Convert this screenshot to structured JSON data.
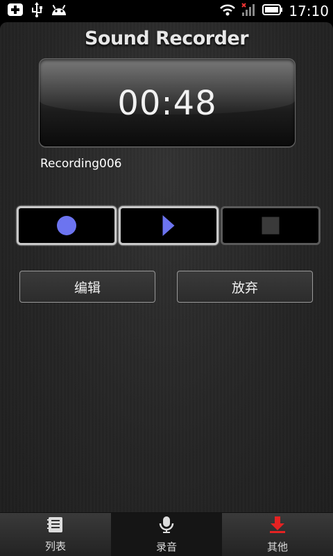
{
  "status_bar": {
    "time": "17:10",
    "left_icons": [
      "add-icon",
      "usb-icon",
      "android-icon"
    ],
    "right_icons": [
      "wifi-icon",
      "signal-icon",
      "battery-icon"
    ]
  },
  "app": {
    "title": "Sound Recorder",
    "timer": "00:48",
    "recording_name": "Recording006"
  },
  "controls": {
    "record": {
      "icon": "record-icon",
      "color": "#6c74f0"
    },
    "play": {
      "icon": "play-icon",
      "color": "#6c74f0"
    },
    "stop": {
      "icon": "stop-icon",
      "enabled": false
    }
  },
  "actions": {
    "edit_label": "编辑",
    "discard_label": "放弃"
  },
  "bottom_nav": {
    "tabs": [
      {
        "label": "列表",
        "icon": "list-icon"
      },
      {
        "label": "录音",
        "icon": "microphone-icon",
        "active": true
      },
      {
        "label": "其他",
        "icon": "download-icon"
      }
    ]
  }
}
